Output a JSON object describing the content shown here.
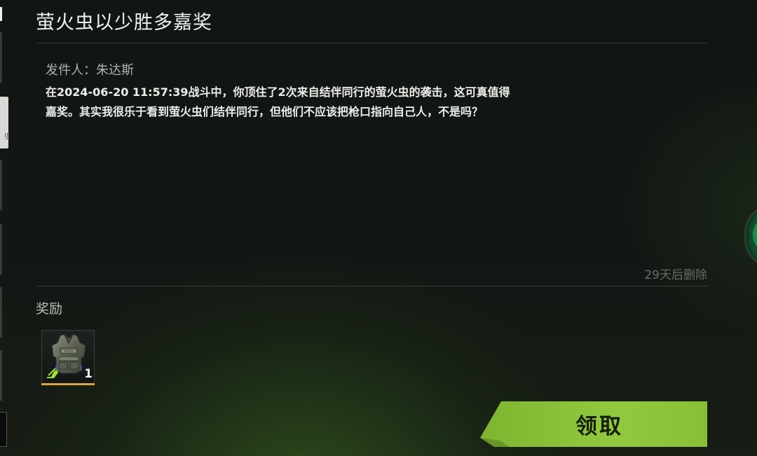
{
  "mail": {
    "title": "萤火虫以少胜多嘉奖",
    "sender": "发件人：朱达斯",
    "body_lines": [
      "在2024-06-20 11:57:39战斗中，你顶住了2次来自结伴同行的萤火虫的袭击，这可真值得",
      "嘉奖。其实我很乐于看到萤火虫们结伴同行，但他们不应该把枪口指向自己人，不是吗？"
    ],
    "expire_text": "29天后删除"
  },
  "rewards": {
    "label": "奖励",
    "items": [
      {
        "icon": "armor-vest-icon",
        "quantity": "1",
        "rarity_color": "#e2a33a"
      }
    ]
  },
  "claim_button": {
    "label": "领取",
    "color": "#8dc63f"
  },
  "left_panel": {
    "active_tab_glyph": "刂"
  },
  "colors": {
    "background": "#131714",
    "accent_green": "#8dc63f",
    "rarity_orange": "#e2a33a",
    "knob_green": "#1c8b4c"
  }
}
